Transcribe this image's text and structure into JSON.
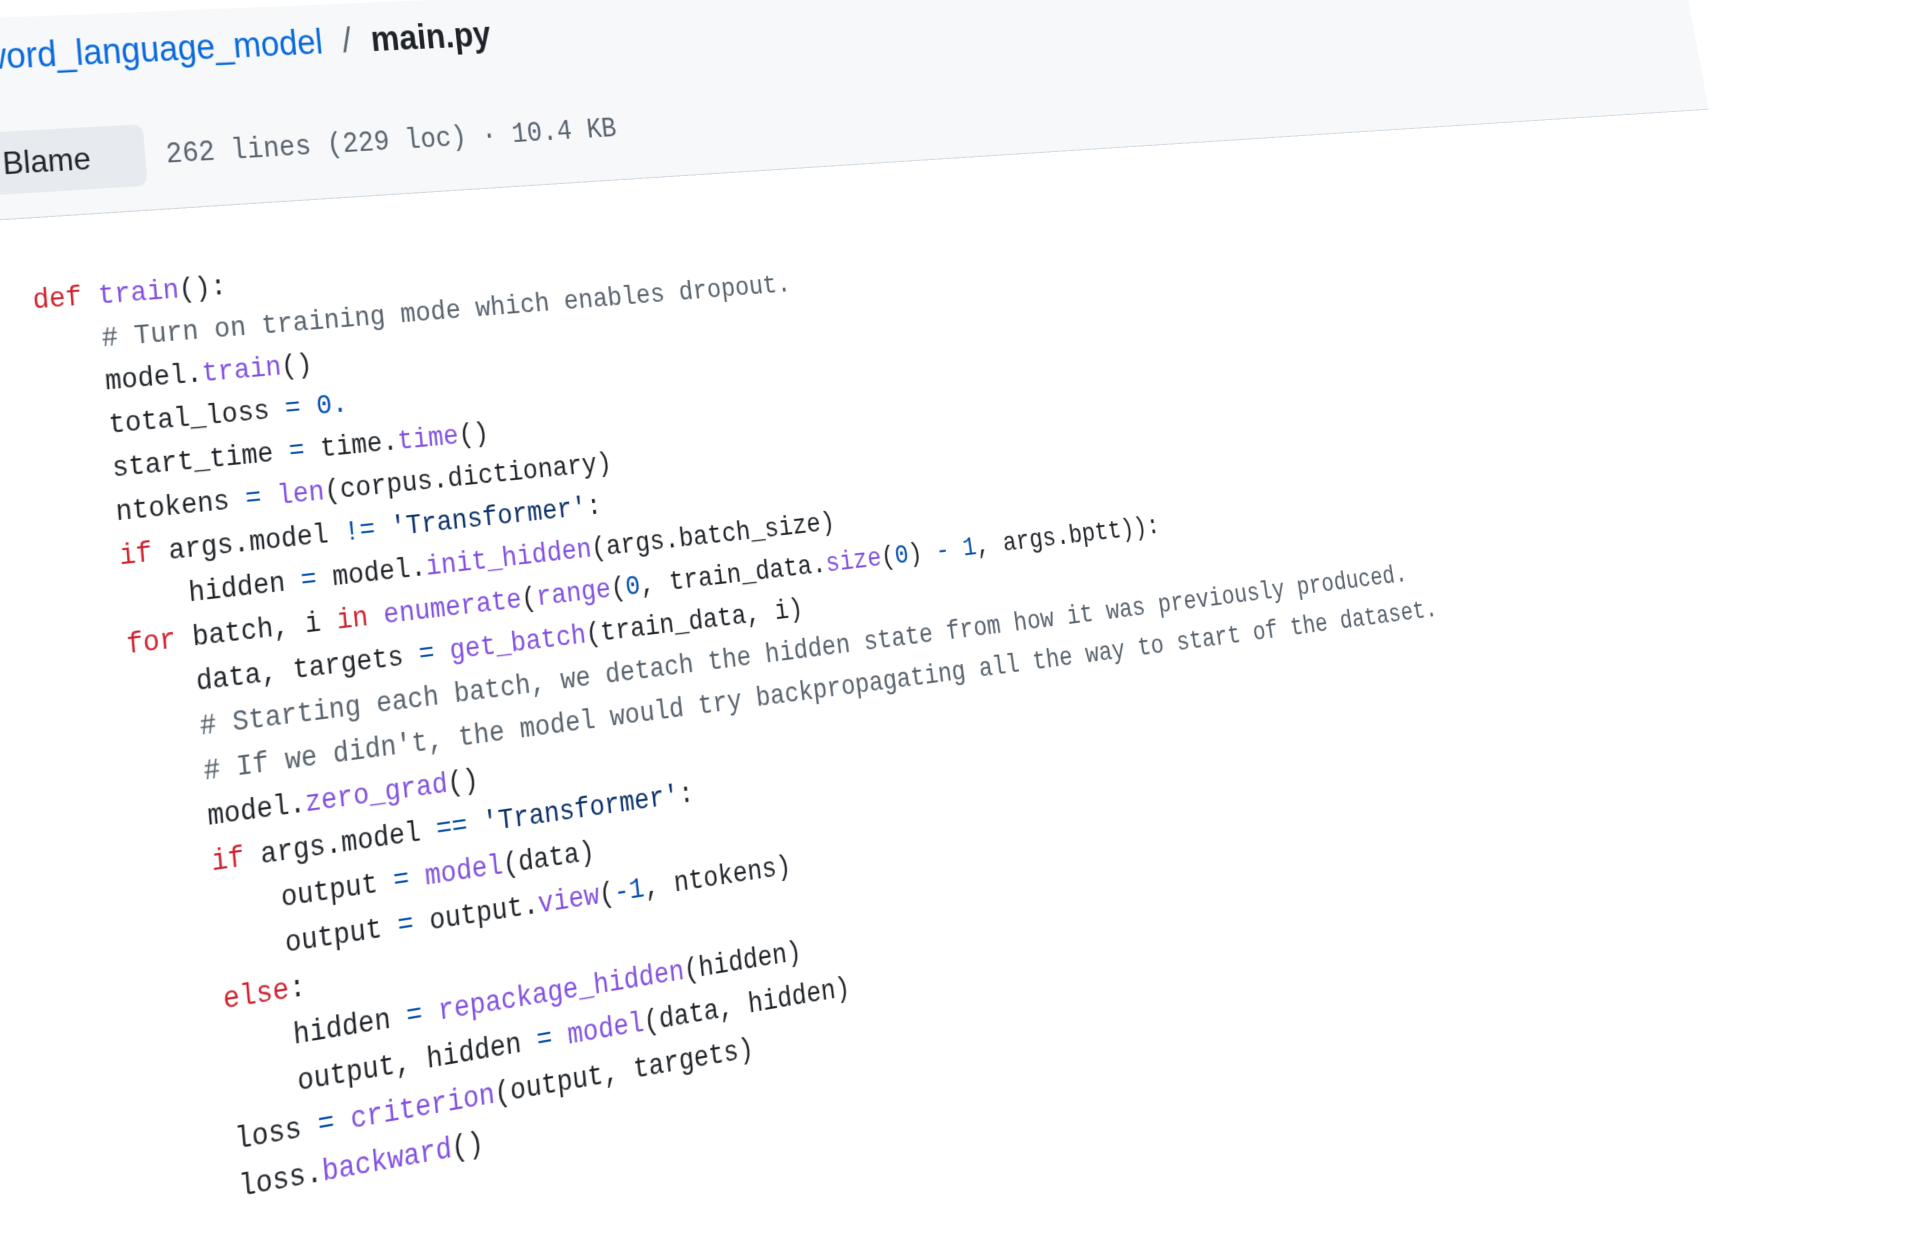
{
  "breadcrumb": {
    "lead_sep": "/",
    "folder": "word_language_model",
    "sep": "/",
    "file": "main.py"
  },
  "file_header": {
    "blame_label": "Blame",
    "meta": "262 lines (229 loc) · 10.4 KB"
  },
  "code": {
    "lines": [
      [
        {
          "t": "def",
          "c": "kw"
        },
        {
          "t": " "
        },
        {
          "t": "train",
          "c": "fn"
        },
        {
          "t": "():"
        }
      ],
      [
        {
          "t": "    "
        },
        {
          "t": "# Turn on training mode which enables dropout.",
          "c": "cm"
        }
      ],
      [
        {
          "t": "    model."
        },
        {
          "t": "train",
          "c": "fn"
        },
        {
          "t": "()"
        }
      ],
      [
        {
          "t": "    total_loss "
        },
        {
          "t": "=",
          "c": "op"
        },
        {
          "t": " "
        },
        {
          "t": "0.",
          "c": "num"
        }
      ],
      [
        {
          "t": "    start_time "
        },
        {
          "t": "=",
          "c": "op"
        },
        {
          "t": " time."
        },
        {
          "t": "time",
          "c": "fn"
        },
        {
          "t": "()"
        }
      ],
      [
        {
          "t": "    ntokens "
        },
        {
          "t": "=",
          "c": "op"
        },
        {
          "t": " "
        },
        {
          "t": "len",
          "c": "fn"
        },
        {
          "t": "(corpus.dictionary)"
        }
      ],
      [
        {
          "t": "    "
        },
        {
          "t": "if",
          "c": "kw"
        },
        {
          "t": " args.model "
        },
        {
          "t": "!=",
          "c": "op"
        },
        {
          "t": " "
        },
        {
          "t": "'Transformer'",
          "c": "str"
        },
        {
          "t": ":"
        }
      ],
      [
        {
          "t": "        hidden "
        },
        {
          "t": "=",
          "c": "op"
        },
        {
          "t": " model."
        },
        {
          "t": "init_hidden",
          "c": "fn"
        },
        {
          "t": "(args.batch_size)"
        }
      ],
      [
        {
          "t": "    "
        },
        {
          "t": "for",
          "c": "kw"
        },
        {
          "t": " batch, i "
        },
        {
          "t": "in",
          "c": "kw"
        },
        {
          "t": " "
        },
        {
          "t": "enumerate",
          "c": "fn"
        },
        {
          "t": "("
        },
        {
          "t": "range",
          "c": "fn"
        },
        {
          "t": "("
        },
        {
          "t": "0",
          "c": "num"
        },
        {
          "t": ", train_data."
        },
        {
          "t": "size",
          "c": "fn"
        },
        {
          "t": "("
        },
        {
          "t": "0",
          "c": "num"
        },
        {
          "t": ") "
        },
        {
          "t": "-",
          "c": "op"
        },
        {
          "t": " "
        },
        {
          "t": "1",
          "c": "num"
        },
        {
          "t": ", args.bptt)):"
        }
      ],
      [
        {
          "t": "        data, targets "
        },
        {
          "t": "=",
          "c": "op"
        },
        {
          "t": " "
        },
        {
          "t": "get_batch",
          "c": "fn"
        },
        {
          "t": "(train_data, i)"
        }
      ],
      [
        {
          "t": "        "
        },
        {
          "t": "# Starting each batch, we detach the hidden state from how it was previously produced.",
          "c": "cm"
        }
      ],
      [
        {
          "t": "        "
        },
        {
          "t": "# If we didn't, the model would try backpropagating all the way to start of the dataset.",
          "c": "cm"
        }
      ],
      [
        {
          "t": "        model."
        },
        {
          "t": "zero_grad",
          "c": "fn"
        },
        {
          "t": "()"
        }
      ],
      [
        {
          "t": "        "
        },
        {
          "t": "if",
          "c": "kw"
        },
        {
          "t": " args.model "
        },
        {
          "t": "==",
          "c": "op"
        },
        {
          "t": " "
        },
        {
          "t": "'Transformer'",
          "c": "str"
        },
        {
          "t": ":"
        }
      ],
      [
        {
          "t": "            output "
        },
        {
          "t": "=",
          "c": "op"
        },
        {
          "t": " "
        },
        {
          "t": "model",
          "c": "fn"
        },
        {
          "t": "(data)"
        }
      ],
      [
        {
          "t": "            output "
        },
        {
          "t": "=",
          "c": "op"
        },
        {
          "t": " output."
        },
        {
          "t": "view",
          "c": "fn"
        },
        {
          "t": "("
        },
        {
          "t": "-1",
          "c": "num"
        },
        {
          "t": ", ntokens)"
        }
      ],
      [
        {
          "t": "        "
        },
        {
          "t": "else",
          "c": "kw"
        },
        {
          "t": ":"
        }
      ],
      [
        {
          "t": "            hidden "
        },
        {
          "t": "=",
          "c": "op"
        },
        {
          "t": " "
        },
        {
          "t": "repackage_hidden",
          "c": "fn"
        },
        {
          "t": "(hidden)"
        }
      ],
      [
        {
          "t": "            output, hidden "
        },
        {
          "t": "=",
          "c": "op"
        },
        {
          "t": " "
        },
        {
          "t": "model",
          "c": "fn"
        },
        {
          "t": "(data, hidden)"
        }
      ],
      [
        {
          "t": "        loss "
        },
        {
          "t": "=",
          "c": "op"
        },
        {
          "t": " "
        },
        {
          "t": "criterion",
          "c": "fn"
        },
        {
          "t": "(output, targets)"
        }
      ],
      [
        {
          "t": "        loss."
        },
        {
          "t": "backward",
          "c": "fn"
        },
        {
          "t": "()"
        }
      ]
    ]
  }
}
